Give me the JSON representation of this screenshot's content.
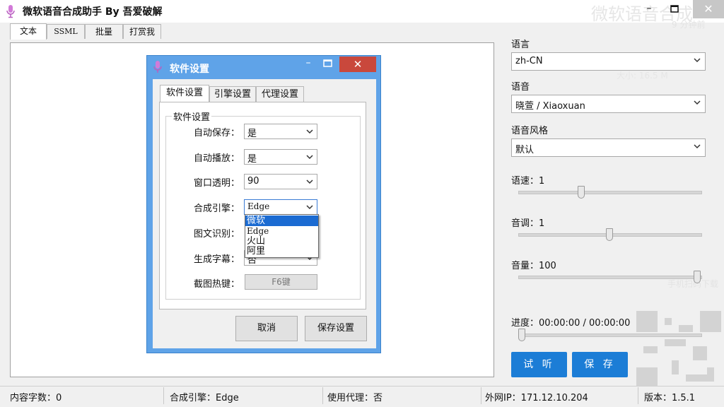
{
  "window": {
    "title": "微软语音合成助手 By 吾爱破解",
    "minimize": "–",
    "close": "✕",
    "watermark": "微软语音合成",
    "watermark_sub1": "9 分钟前",
    "watermark_sub2": "大小: 16.5 M",
    "watermark_sub3": "手机扫码下载"
  },
  "tabs": [
    "文本",
    "SSML",
    "批量",
    "打赏我"
  ],
  "right": {
    "language_label": "语言",
    "language_value": "zh-CN",
    "voice_label": "语音",
    "voice_value": "晓萱 / Xiaoxuan",
    "style_label": "语音风格",
    "style_value": "默认",
    "rate_label": "语速：1",
    "rate_level": 0.34,
    "pitch_label": "音调：1",
    "pitch_level": 0.5,
    "volume_label": "音量：100",
    "volume_level": 1.0,
    "progress_label": "进度：00:00:00 / 00:00:00",
    "progress_level": 0.0,
    "listen_button": "试 听",
    "save_button": "保 存"
  },
  "status": {
    "chars": "内容字数：0",
    "engine": "合成引擎：Edge",
    "proxy": "使用代理：否",
    "ip": "外网IP：171.12.10.204",
    "version": "版本：1.5.1"
  },
  "dialog": {
    "title": "软件设置",
    "close": "✕",
    "minimize": "–",
    "tabs": [
      "软件设置",
      "引擎设置",
      "代理设置"
    ],
    "group_title": "软件设置",
    "fields": [
      {
        "label": "自动保存：",
        "value": "是"
      },
      {
        "label": "自动播放：",
        "value": "是"
      },
      {
        "label": "窗口透明：",
        "value": "90"
      },
      {
        "label": "合成引擎：",
        "value": "Edge"
      },
      {
        "label": "图文识别：",
        "value": ""
      },
      {
        "label": "生成字幕：",
        "value": "否"
      },
      {
        "label": "截图热键：",
        "value": "F6键"
      }
    ],
    "engine_options": [
      "微软",
      "Edge",
      "火山",
      "阿里"
    ],
    "cancel_button": "取消",
    "save_button": "保存设置"
  },
  "colors": {
    "accent": "#1c7dd6",
    "dialog_title": "#5fa3e8",
    "dialog_close": "#c9483c"
  }
}
